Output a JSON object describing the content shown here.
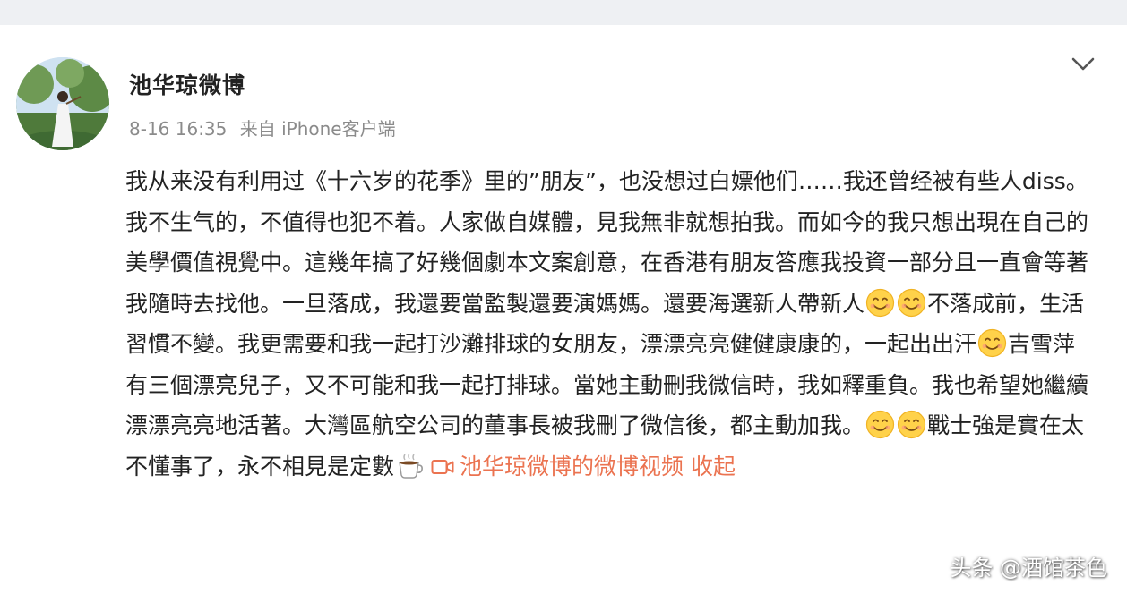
{
  "post": {
    "username": "池华琼微博",
    "time": "8-16 16:35",
    "source": "来自 iPhone客户端",
    "text": {
      "p1": "我从来没有利用过《十六岁的花季》里的”朋友”，也没想过白嫖他们……我还曾经被有些人diss。我不生气的，不值得也犯不着。人家做自媒體，見我無非就想拍我。而如今的我只想出現在自己的美學價值視覺中。這幾年搞了好幾個劇本文案創意，在香港有朋友答應我投資一部分且一直會等著我隨時去找他。一旦落成，我還要當監製還要演媽媽。還要海選新人帶新人",
      "p2": "不落成前，生活習慣不變。我更需要和我一起打沙灘排球的女朋友，漂漂亮亮健健康康的，一起出出汗",
      "p3": "吉雪萍有三個漂亮兒子，又不可能和我一起打排球。當她主動刪我微信時，我如釋重負。我也希望她繼續漂漂亮亮地活著。大灣區航空公司的董事長被我刪了微信後，都主動加我。",
      "p4": "戰士強是實在太不懂事了，永不相見是定數",
      "video_link": "池华琼微博的微博视频",
      "collapse": "收起"
    }
  },
  "watermark": "头条 @酒馆茶色",
  "icons": {
    "menu": "chevron-down-icon",
    "smile": "smile-emoji-icon",
    "coffee": "coffee-emoji-icon",
    "video": "video-camera-icon"
  },
  "colors": {
    "link": "#eb7350",
    "text": "#222222",
    "meta": "#8b8b8b"
  }
}
